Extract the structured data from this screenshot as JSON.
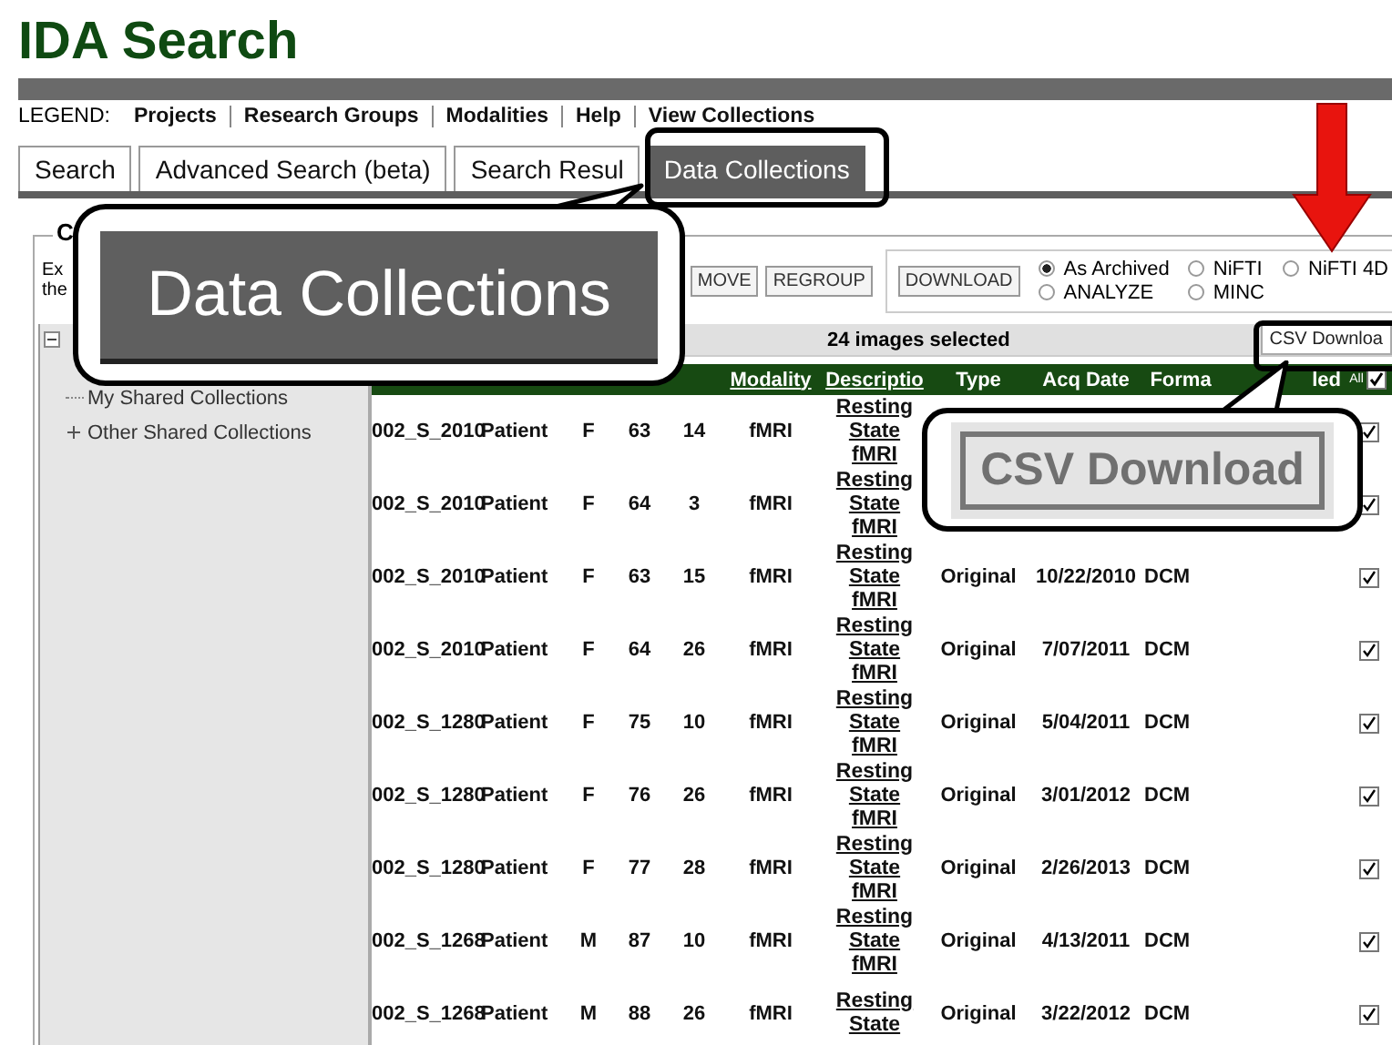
{
  "page_title": "IDA Search",
  "legend": {
    "label": "LEGEND:",
    "links": [
      "Projects",
      "Research Groups",
      "Modalities",
      "Help",
      "View Collections"
    ]
  },
  "tabs": [
    {
      "label": "Search",
      "selected": false
    },
    {
      "label": "Advanced Search (beta)",
      "selected": false
    },
    {
      "label": "Search Resul",
      "selected": false
    },
    {
      "label": "Data Collections",
      "selected": true
    }
  ],
  "panel": {
    "legend": "C",
    "description": [
      "Ex",
      "the"
    ]
  },
  "toolbar": {
    "buttons": [
      "MOVE",
      "REGROUP"
    ],
    "download_button": "DOWNLOAD",
    "formats": [
      {
        "label": "As Archived",
        "selected": true
      },
      {
        "label": "NiFTI",
        "selected": false
      },
      {
        "label": "NiFTI 4D",
        "selected": false
      },
      {
        "label": "ANALYZE",
        "selected": false
      },
      {
        "label": "MINC",
        "selected": false
      }
    ]
  },
  "tree": {
    "expanded": true,
    "children": [
      {
        "label": "My Shared Collections",
        "kind": "leaf"
      },
      {
        "label": "Other Shared Collections",
        "kind": "folder",
        "expanded": false
      }
    ]
  },
  "selection_count": "24 images selected",
  "csv_button": "CSV Downloa",
  "table": {
    "header": {
      "modality": "Modality",
      "description": "Descriptio",
      "type": "Type",
      "acq_date": "Acq Date",
      "format": "Forma",
      "column_11": "led",
      "all_label": "All",
      "all_checked": true
    },
    "rows": [
      {
        "subject": "002_S_2010",
        "group": "Patient",
        "sex": "F",
        "age": "63",
        "visit": "14",
        "modality": "fMRI",
        "description": "Resting State fMRI",
        "checked": true
      },
      {
        "subject": "002_S_2010",
        "group": "Patient",
        "sex": "F",
        "age": "64",
        "visit": "3",
        "modality": "fMRI",
        "description": "Resting State fMRI",
        "checked": true
      },
      {
        "subject": "002_S_2010",
        "group": "Patient",
        "sex": "F",
        "age": "63",
        "visit": "15",
        "modality": "fMRI",
        "description": "Resting State fMRI",
        "type": "Original",
        "acq_date": "10/22/2010",
        "format": "DCM",
        "checked": true
      },
      {
        "subject": "002_S_2010",
        "group": "Patient",
        "sex": "F",
        "age": "64",
        "visit": "26",
        "modality": "fMRI",
        "description": "Resting State fMRI",
        "type": "Original",
        "acq_date": "7/07/2011",
        "format": "DCM",
        "checked": true
      },
      {
        "subject": "002_S_1280",
        "group": "Patient",
        "sex": "F",
        "age": "75",
        "visit": "10",
        "modality": "fMRI",
        "description": "Resting State fMRI",
        "type": "Original",
        "acq_date": "5/04/2011",
        "format": "DCM",
        "checked": true
      },
      {
        "subject": "002_S_1280",
        "group": "Patient",
        "sex": "F",
        "age": "76",
        "visit": "26",
        "modality": "fMRI",
        "description": "Resting State fMRI",
        "type": "Original",
        "acq_date": "3/01/2012",
        "format": "DCM",
        "checked": true
      },
      {
        "subject": "002_S_1280",
        "group": "Patient",
        "sex": "F",
        "age": "77",
        "visit": "28",
        "modality": "fMRI",
        "description": "Resting State fMRI",
        "type": "Original",
        "acq_date": "2/26/2013",
        "format": "DCM",
        "checked": true
      },
      {
        "subject": "002_S_1268",
        "group": "Patient",
        "sex": "M",
        "age": "87",
        "visit": "10",
        "modality": "fMRI",
        "description": "Resting State fMRI",
        "type": "Original",
        "acq_date": "4/13/2011",
        "format": "DCM",
        "checked": true
      },
      {
        "subject": "002_S_1268",
        "group": "Patient",
        "sex": "M",
        "age": "88",
        "visit": "26",
        "modality": "fMRI",
        "description": "Resting State",
        "type": "Original",
        "acq_date": "3/22/2012",
        "format": "DCM",
        "checked": true
      }
    ]
  },
  "callouts": [
    "Data Collections",
    "CSV Download"
  ]
}
